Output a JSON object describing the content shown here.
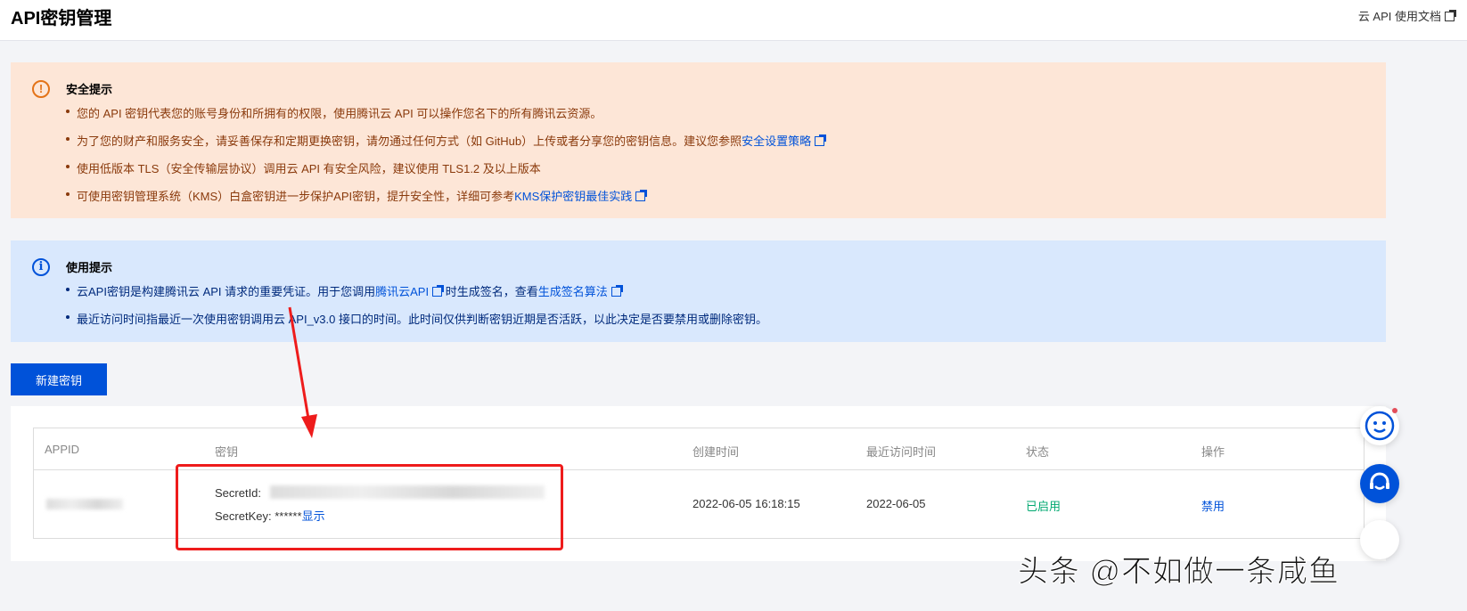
{
  "header": {
    "title": "API密钥管理",
    "doc_link": "云 API 使用文档"
  },
  "security": {
    "title": "安全提示",
    "items": [
      {
        "text": "您的 API 密钥代表您的账号身份和所拥有的权限，使用腾讯云 API 可以操作您名下的所有腾讯云资源。"
      },
      {
        "text": "为了您的财产和服务安全，请妥善保存和定期更换密钥，请勿通过任何方式（如 GitHub）上传或者分享您的密钥信息。建议您参照",
        "link": "安全设置策略"
      },
      {
        "text": "使用低版本 TLS（安全传输层协议）调用云 API 有安全风险，建议使用 TLS1.2 及以上版本"
      },
      {
        "text": "可使用密钥管理系统（KMS）白盒密钥进一步保护API密钥，提升安全性，详细可参考",
        "link": "KMS保护密钥最佳实践"
      }
    ]
  },
  "usage": {
    "title": "使用提示",
    "item1_a": "云API密钥是构建腾讯云 API 请求的重要凭证。用于您调用",
    "item1_link1": "腾讯云API",
    "item1_b": "时生成签名，查看",
    "item1_link2": "生成签名算法",
    "item2": "最近访问时间指最近一次使用密钥调用云 API_v3.0 接口的时间。此时间仅供判断密钥近期是否活跃，以此决定是否要禁用或删除密钥。"
  },
  "new_key_button": "新建密钥",
  "table": {
    "columns": [
      "APPID",
      "密钥",
      "创建时间",
      "最近访问时间",
      "状态",
      "操作"
    ],
    "row": {
      "secret_id_label": "SecretId:",
      "secret_key_label": "SecretKey: ******",
      "show": "显示",
      "created": "2022-06-05 16:18:15",
      "last_access": "2022-06-05",
      "status": "已启用",
      "action": "禁用"
    }
  },
  "colors": {
    "primary": "#0052d9",
    "status_green": "#00a870",
    "annotation": "#ee1c1c"
  },
  "watermark": "头条 @不如做一条咸鱼"
}
